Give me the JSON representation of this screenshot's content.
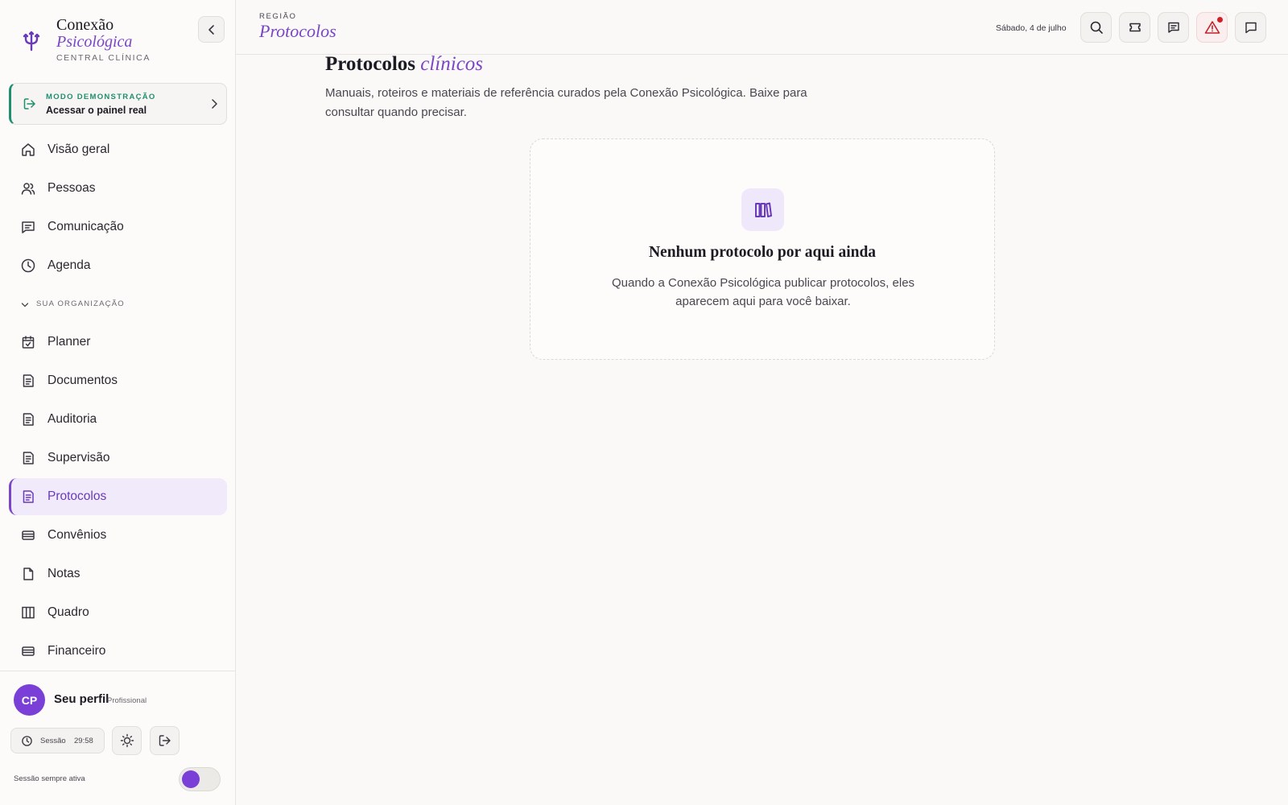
{
  "brand": {
    "name_line1": "Conexão",
    "name_line2": "Psicológica",
    "subtitle": "CENTRAL CLÍNICA",
    "logo_icon": "psi-icon"
  },
  "demo": {
    "kicker": "MODO DEMONSTRAÇÃO",
    "title": "Acessar o painel real"
  },
  "nav_primary": [
    {
      "label": "Visão geral",
      "icon": "home-icon"
    },
    {
      "label": "Pessoas",
      "icon": "users-icon"
    },
    {
      "label": "Comunicação",
      "icon": "chat-icon"
    },
    {
      "label": "Agenda",
      "icon": "clock-icon"
    }
  ],
  "org_section": {
    "label": "SUA ORGANIZAÇÃO"
  },
  "nav_org": [
    {
      "label": "Planner",
      "icon": "calendar-check-icon"
    },
    {
      "label": "Documentos",
      "icon": "document-icon"
    },
    {
      "label": "Auditoria",
      "icon": "document-icon"
    },
    {
      "label": "Supervisão",
      "icon": "document-icon"
    },
    {
      "label": "Protocolos",
      "icon": "document-icon",
      "active": true
    },
    {
      "label": "Convênios",
      "icon": "card-icon"
    },
    {
      "label": "Notas",
      "icon": "file-icon"
    },
    {
      "label": "Quadro",
      "icon": "board-icon"
    },
    {
      "label": "Financeiro",
      "icon": "card-icon"
    }
  ],
  "profile": {
    "initials": "CP",
    "name": "Seu perfil",
    "role": "Profissional"
  },
  "session": {
    "label": "Sessão",
    "time": "29:58",
    "always_on_label": "Sessão sempre ativa",
    "always_on": true
  },
  "topbar": {
    "kicker": "REGIÃO",
    "title": "Protocolos",
    "date": "Sábado, 4 de julho",
    "actions": [
      "search-icon",
      "ticket-icon",
      "message-icon",
      "alert-triangle-icon",
      "comment-icon"
    ]
  },
  "page": {
    "title": "Protocolos",
    "title_accent": "clínicos",
    "description": "Manuais, roteiros e materiais de referência curados pela Conexão Psicológica. Baixe para consultar quando precisar."
  },
  "empty_state": {
    "icon": "library-icon",
    "title": "Nenhum protocolo por aqui ainda",
    "description": "Quando a Conexão Psicológica publicar protocolos, eles aparecem aqui para você baixar."
  },
  "colors": {
    "accent": "#7a45c6",
    "demo_green": "#1f8f6f",
    "alert_red": "#d11f2a",
    "background": "#faf9f8"
  }
}
